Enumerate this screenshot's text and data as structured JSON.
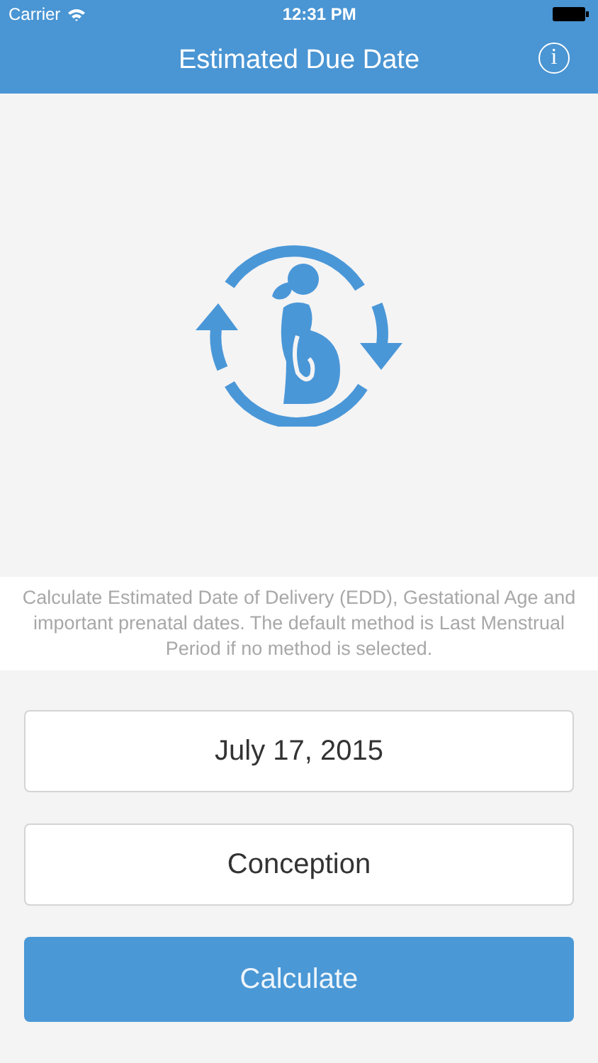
{
  "status_bar": {
    "carrier": "Carrier",
    "time": "12:31 PM"
  },
  "nav_bar": {
    "title": "Estimated Due Date",
    "info_button": "i"
  },
  "description": "Calculate Estimated Date of Delivery (EDD), Gestational Age and important prenatal dates. The default method is Last Menstrual Period if no method is selected.",
  "fields": [
    {
      "value": "July 17, 2015"
    },
    {
      "value": "Conception"
    }
  ],
  "calculate_button": "Calculate"
}
